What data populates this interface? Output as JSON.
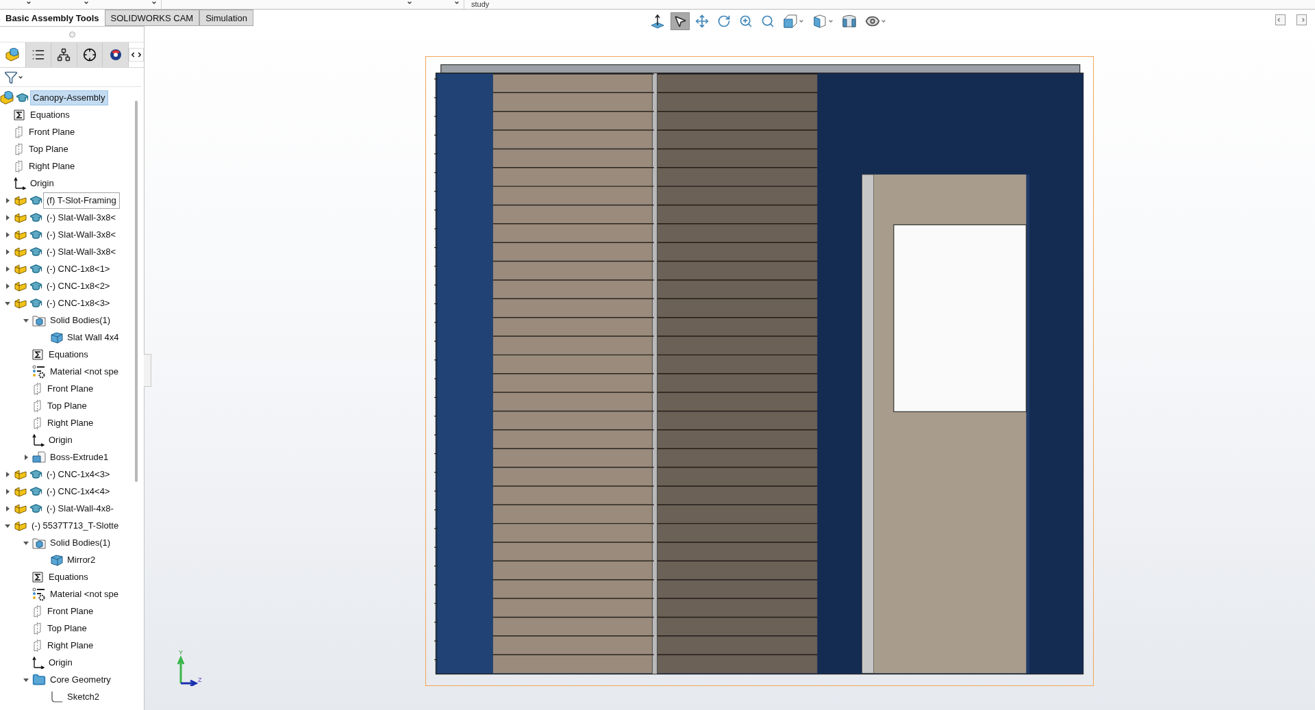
{
  "top_strip": {
    "text": "study"
  },
  "tabs": [
    {
      "label": "Basic Assembly Tools",
      "selected": true
    },
    {
      "label": "SOLIDWORKS CAM",
      "selected": false
    },
    {
      "label": "Simulation",
      "selected": false
    }
  ],
  "panel_tabs": [
    {
      "kind": "feature-manager",
      "selected": true
    },
    {
      "kind": "property-manager",
      "selected": false
    },
    {
      "kind": "configuration-manager",
      "selected": false
    },
    {
      "kind": "dimxpert",
      "selected": false
    },
    {
      "kind": "display-manager",
      "selected": false
    }
  ],
  "view_toolbar": [
    {
      "kind": "orient",
      "selected": false,
      "caret": false
    },
    {
      "kind": "select",
      "selected": true,
      "caret": false
    },
    {
      "kind": "pan",
      "selected": false,
      "caret": false
    },
    {
      "kind": "rotate",
      "selected": false,
      "caret": false
    },
    {
      "kind": "zoom-fit",
      "selected": false,
      "caret": false
    },
    {
      "kind": "zoom-area",
      "selected": false,
      "caret": false
    },
    {
      "kind": "view-orientation",
      "selected": false,
      "caret": true
    },
    {
      "kind": "display-style",
      "selected": false,
      "caret": true
    },
    {
      "kind": "section",
      "selected": false,
      "caret": false
    },
    {
      "kind": "hide-show",
      "selected": false,
      "caret": true
    }
  ],
  "tree": {
    "label": "Canopy-Assembly",
    "kind": "root",
    "selected": true,
    "focused": false,
    "children": [
      {
        "label": "Equations",
        "kind": "equations",
        "selected": false,
        "focused": false
      },
      {
        "label": "Front Plane",
        "kind": "plane",
        "selected": false,
        "focused": false
      },
      {
        "label": "Top Plane",
        "kind": "plane",
        "selected": false,
        "focused": false
      },
      {
        "label": "Right Plane",
        "kind": "plane",
        "selected": false,
        "focused": false
      },
      {
        "label": "Origin",
        "kind": "origin",
        "selected": false,
        "focused": false
      },
      {
        "label": "(f) T-Slot-Framing",
        "kind": "assembly",
        "selected": false,
        "focused": true,
        "expanded": false
      },
      {
        "label": "(-) Slat-Wall-3x8<",
        "kind": "assembly",
        "selected": false,
        "focused": false,
        "expanded": false
      },
      {
        "label": "(-) Slat-Wall-3x8<",
        "kind": "assembly",
        "selected": false,
        "focused": false,
        "expanded": false
      },
      {
        "label": "(-) Slat-Wall-3x8<",
        "kind": "assembly",
        "selected": false,
        "focused": false,
        "expanded": false
      },
      {
        "label": "(-) CNC-1x8<1>",
        "kind": "assembly",
        "selected": false,
        "focused": false,
        "expanded": false
      },
      {
        "label": "(-) CNC-1x8<2>",
        "kind": "assembly",
        "selected": false,
        "focused": false,
        "expanded": false
      },
      {
        "label": "(-) CNC-1x8<3>",
        "kind": "assembly",
        "selected": false,
        "focused": false,
        "expanded": true,
        "children": [
          {
            "label": "Solid Bodies(1)",
            "kind": "body-folder",
            "selected": false,
            "focused": false,
            "expanded": true,
            "children": [
              {
                "label": "Slat Wall 4x4",
                "kind": "body",
                "selected": false,
                "focused": false
              }
            ]
          },
          {
            "label": "Equations",
            "kind": "equations",
            "selected": false,
            "focused": false
          },
          {
            "label": "Material <not spe",
            "kind": "material",
            "selected": false,
            "focused": false
          },
          {
            "label": "Front Plane",
            "kind": "plane",
            "selected": false,
            "focused": false
          },
          {
            "label": "Top Plane",
            "kind": "plane",
            "selected": false,
            "focused": false
          },
          {
            "label": "Right Plane",
            "kind": "plane",
            "selected": false,
            "focused": false
          },
          {
            "label": "Origin",
            "kind": "origin",
            "selected": false,
            "focused": false
          },
          {
            "label": "Boss-Extrude1",
            "kind": "feature",
            "selected": false,
            "focused": false,
            "expanded": false
          }
        ]
      },
      {
        "label": "(-) CNC-1x4<3>",
        "kind": "assembly",
        "selected": false,
        "focused": false,
        "expanded": false
      },
      {
        "label": "(-) CNC-1x4<4>",
        "kind": "assembly",
        "selected": false,
        "focused": false,
        "expanded": false
      },
      {
        "label": "(-) Slat-Wall-4x8-",
        "kind": "assembly",
        "selected": false,
        "focused": false,
        "expanded": false
      },
      {
        "label": "(-) 5537T713_T-Slotte",
        "kind": "part",
        "selected": false,
        "focused": false,
        "expanded": true,
        "children": [
          {
            "label": "Solid Bodies(1)",
            "kind": "body-folder",
            "selected": false,
            "focused": false,
            "expanded": true,
            "children": [
              {
                "label": "Mirror2",
                "kind": "body",
                "selected": false,
                "focused": false
              }
            ]
          },
          {
            "label": "Equations",
            "kind": "equations",
            "selected": false,
            "focused": false
          },
          {
            "label": "Material <not spe",
            "kind": "material",
            "selected": false,
            "focused": false
          },
          {
            "label": "Front Plane",
            "kind": "plane",
            "selected": false,
            "focused": false
          },
          {
            "label": "Top Plane",
            "kind": "plane",
            "selected": false,
            "focused": false
          },
          {
            "label": "Right Plane",
            "kind": "plane",
            "selected": false,
            "focused": false
          },
          {
            "label": "Origin",
            "kind": "origin",
            "selected": false,
            "focused": false
          },
          {
            "label": "Core Geometry",
            "kind": "folder",
            "selected": false,
            "focused": false,
            "expanded": true,
            "children": [
              {
                "label": "Sketch2",
                "kind": "sketch",
                "selected": false,
                "focused": false
              }
            ]
          }
        ]
      }
    ]
  },
  "triad": {
    "y_label": "Y",
    "z_label": "Z"
  }
}
